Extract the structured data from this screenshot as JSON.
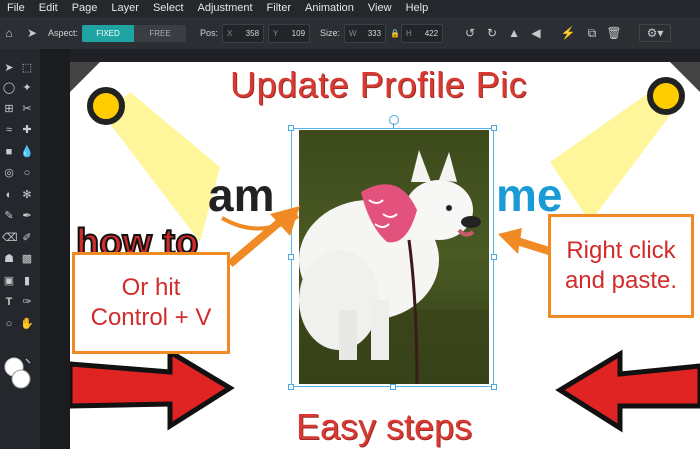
{
  "menu": [
    "File",
    "Edit",
    "Page",
    "Layer",
    "Select",
    "Adjustment",
    "Filter",
    "Animation",
    "View",
    "Help"
  ],
  "toolbar": {
    "aspect_label": "Aspect:",
    "fixed_label": "FIXED",
    "free_label": "FREE",
    "pos_label": "Pos:",
    "pos_x_key": "X",
    "pos_x_value": "358",
    "pos_y_key": "Y",
    "pos_y_value": "109",
    "size_label": "Size:",
    "size_w_key": "W",
    "size_w_value": "333",
    "size_h_key": "H",
    "size_h_value": "422"
  },
  "canvas": {
    "title": "Update Profile Pic",
    "bottom_title": "Easy steps",
    "logo_left": "am",
    "logo_right": "me",
    "howto": "how to",
    "callout_left": "Or hit Control + V",
    "callout_left_line1": "Or hit",
    "callout_left_line2": "Control + V",
    "callout_right_line1": "Right click",
    "callout_right_line2": "and paste."
  },
  "colors": {
    "accent_teal": "#1fa3a3",
    "title_red": "#d63a32",
    "callout_border": "#f08a24",
    "selection_blue": "#56b6e8"
  }
}
